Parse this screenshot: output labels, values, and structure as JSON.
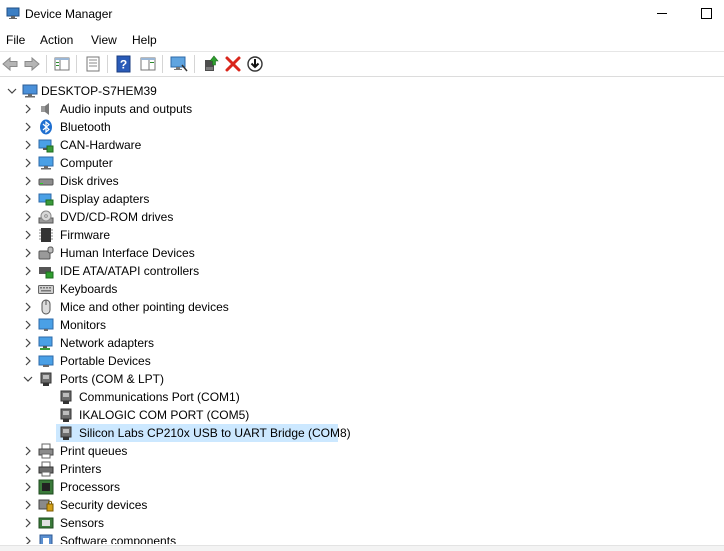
{
  "window": {
    "title": "Device Manager"
  },
  "menu": [
    "File",
    "Action",
    "View",
    "Help"
  ],
  "toolbar": {
    "buttons": [
      "back-arrow-icon",
      "forward-arrow-icon",
      "show-hide-console-tree-icon",
      "properties-icon",
      "help-icon",
      "action-pane-icon",
      "scan-hardware-icon",
      "update-driver-icon",
      "uninstall-device-icon",
      "download-driver-icon"
    ]
  },
  "tree": {
    "root": "DESKTOP-S7HEM39",
    "categories": [
      {
        "label": "Audio inputs and outputs",
        "icon": "speaker-icon"
      },
      {
        "label": "Bluetooth",
        "icon": "bluetooth-icon"
      },
      {
        "label": "CAN-Hardware",
        "icon": "network-card-icon"
      },
      {
        "label": "Computer",
        "icon": "computer-icon"
      },
      {
        "label": "Disk drives",
        "icon": "disk-drive-icon"
      },
      {
        "label": "Display adapters",
        "icon": "display-adapter-icon"
      },
      {
        "label": "DVD/CD-ROM drives",
        "icon": "dvd-icon"
      },
      {
        "label": "Firmware",
        "icon": "chip-icon"
      },
      {
        "label": "Human Interface Devices",
        "icon": "hid-icon"
      },
      {
        "label": "IDE ATA/ATAPI controllers",
        "icon": "ide-controller-icon"
      },
      {
        "label": "Keyboards",
        "icon": "keyboard-icon"
      },
      {
        "label": "Mice and other pointing devices",
        "icon": "mouse-icon"
      },
      {
        "label": "Monitors",
        "icon": "monitor-icon"
      },
      {
        "label": "Network adapters",
        "icon": "network-adapter-icon"
      },
      {
        "label": "Portable Devices",
        "icon": "portable-device-icon"
      },
      {
        "label": "Ports (COM & LPT)",
        "icon": "port-icon",
        "expanded": true,
        "children": [
          {
            "label": "Communications Port (COM1)"
          },
          {
            "label": "IKALOGIC COM PORT (COM5)"
          },
          {
            "label": "Silicon Labs CP210x USB to UART Bridge (COM8)",
            "selected": true
          }
        ]
      },
      {
        "label": "Print queues",
        "icon": "print-queue-icon"
      },
      {
        "label": "Printers",
        "icon": "printer-icon"
      },
      {
        "label": "Processors",
        "icon": "processor-icon"
      },
      {
        "label": "Security devices",
        "icon": "security-device-icon"
      },
      {
        "label": "Sensors",
        "icon": "sensor-icon"
      },
      {
        "label": "Software components",
        "icon": "software-component-icon"
      }
    ]
  },
  "colors": {
    "selection": "#cce8ff",
    "delete_red": "#d9261c",
    "help_blue": "#2a5bb8"
  }
}
